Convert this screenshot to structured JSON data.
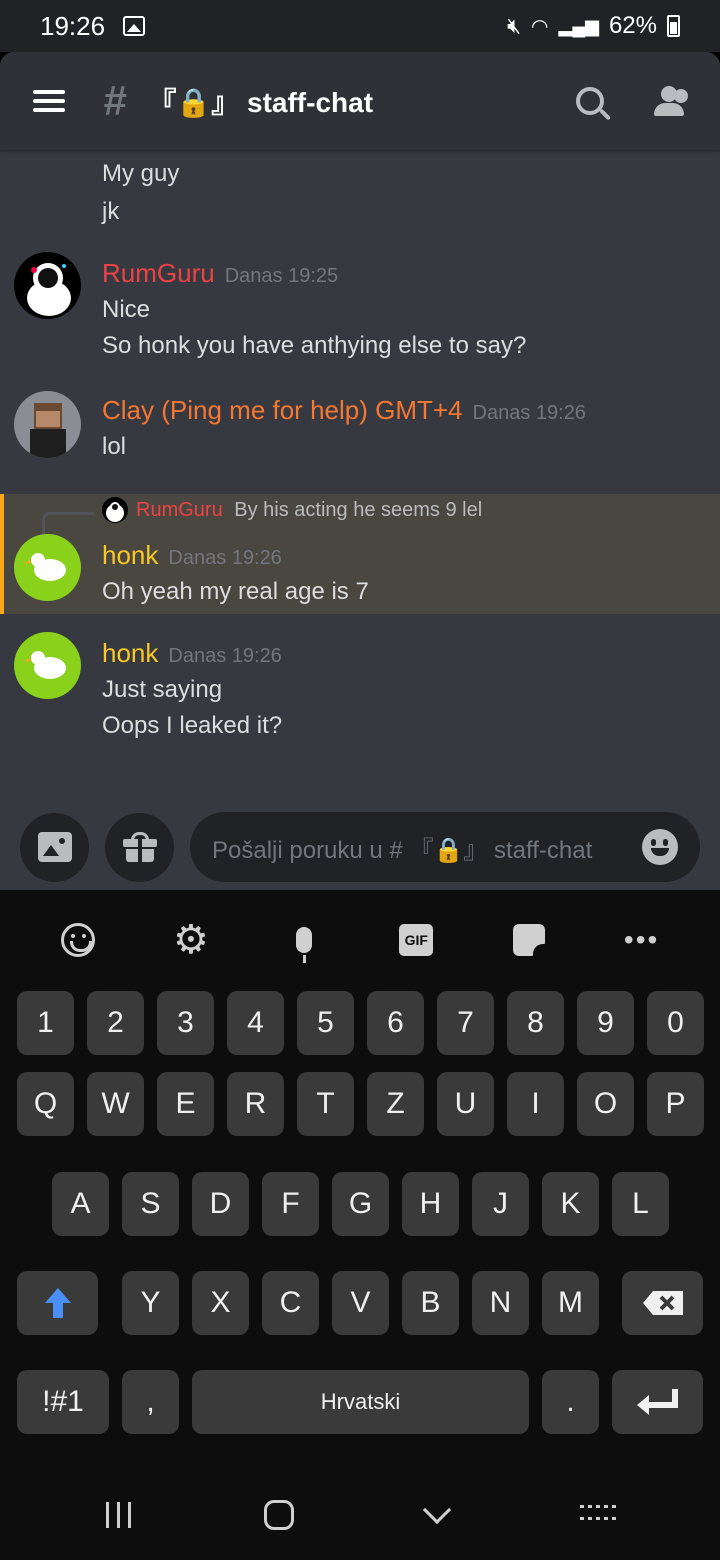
{
  "status_bar": {
    "time": "19:26",
    "battery": "62%"
  },
  "header": {
    "hash": "#",
    "channel": "『🔒』 staff-chat"
  },
  "messages": {
    "lead_lines": [
      "My guy",
      "jk"
    ],
    "groups": [
      {
        "user": "RumGuru",
        "user_color": "#ed4245",
        "ts": "Danas 19:25",
        "lines": [
          "Nice",
          "So honk you have anthying else to say?"
        ]
      },
      {
        "user": "Clay (Ping me for help) GMT+4",
        "user_color": "#f57731",
        "ts": "Danas 19:26",
        "lines": [
          "lol"
        ]
      },
      {
        "user": "honk",
        "user_color": "#f9c824",
        "ts": "Danas 19:26",
        "lines": [
          "Oh yeah my real age is 7"
        ]
      },
      {
        "user": "honk",
        "user_color": "#f9c824",
        "ts": "Danas 19:26",
        "lines": [
          "Just saying",
          "Oops I leaked it?"
        ]
      }
    ],
    "reply": {
      "user": "RumGuru",
      "text": "By his acting he seems 9 lel"
    }
  },
  "input": {
    "placeholder": "Pošalji poruku u # 『🔒』 staff-chat"
  },
  "keyboard": {
    "toolbar": {
      "gif": "GIF",
      "more": "•••"
    },
    "row_numbers": [
      "1",
      "2",
      "3",
      "4",
      "5",
      "6",
      "7",
      "8",
      "9",
      "0"
    ],
    "row1": [
      "Q",
      "W",
      "E",
      "R",
      "T",
      "Z",
      "U",
      "I",
      "O",
      "P"
    ],
    "row2": [
      "A",
      "S",
      "D",
      "F",
      "G",
      "H",
      "J",
      "K",
      "L"
    ],
    "row3": [
      "Y",
      "X",
      "C",
      "V",
      "B",
      "N",
      "M"
    ],
    "sym": "!#1",
    "comma": ",",
    "space": "Hrvatski",
    "period": "."
  },
  "colors": {
    "accent": "#5865f2",
    "mention_bar": "#faa81a",
    "shift": "#4a8ff7"
  }
}
